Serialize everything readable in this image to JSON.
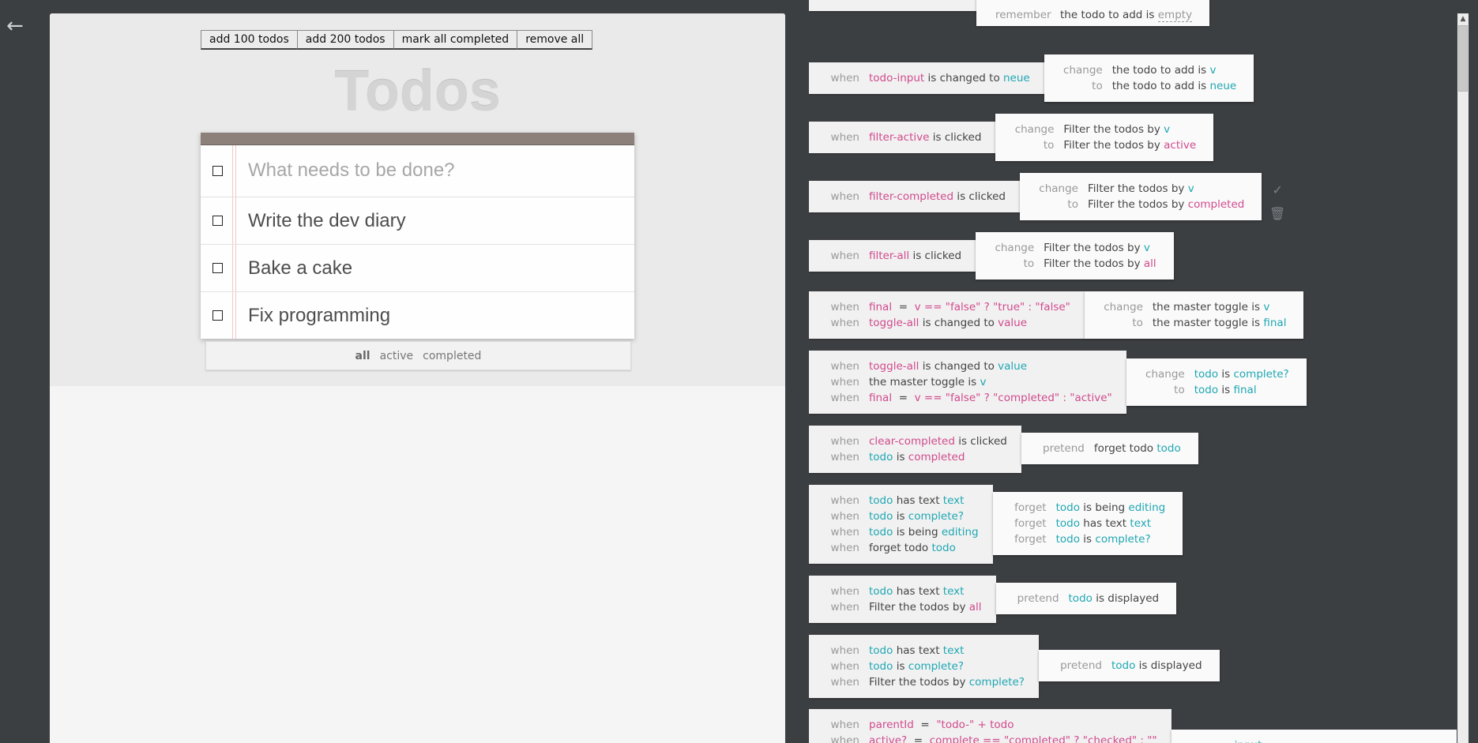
{
  "nav": {
    "back_glyph": "←",
    "back_icon": "arrow-left-icon"
  },
  "bench": {
    "add100": "add 100 todos",
    "add200": "add 200 todos",
    "mark_all": "mark all completed",
    "remove_all": "remove all"
  },
  "app": {
    "title": "Todos",
    "placeholder": "What needs to be done?",
    "todos": [
      {
        "text": "Write the dev diary",
        "complete": false
      },
      {
        "text": "Bake a cake",
        "complete": false
      },
      {
        "text": "Fix programming",
        "complete": false
      }
    ],
    "filters": {
      "all": "all",
      "active": "active",
      "completed": "completed",
      "selected": "all"
    }
  },
  "code": {
    "b0": {
      "r1_kw": "remember",
      "r1_a": "the todo to add is",
      "r1_b": "empty"
    },
    "b1": {
      "l1_kw": "when",
      "l1_tag": "todo-input",
      "l1_mid": "is changed to",
      "l1_tag2": "neue",
      "r1_kw": "change",
      "r1_a": "the todo to add is",
      "r1_v": "v",
      "r2_kw": "to",
      "r2_a": "the todo to add is",
      "r2_v": "neue"
    },
    "b2": {
      "l1_kw": "when",
      "l1_tag": "filter-active",
      "l1_mid": "is clicked",
      "r1_kw": "change",
      "r1_a": "Filter the todos by",
      "r1_v": "v",
      "r2_kw": "to",
      "r2_a": "Filter the todos by",
      "r2_t": "active"
    },
    "b3": {
      "l1_kw": "when",
      "l1_tag": "filter-completed",
      "l1_mid": "is clicked",
      "r1_kw": "change",
      "r1_a": "Filter the todos by",
      "r1_v": "v",
      "r2_kw": "to",
      "r2_a": "Filter the todos by",
      "r2_t": "completed"
    },
    "b4": {
      "l1_kw": "when",
      "l1_tag": "filter-all",
      "l1_mid": "is clicked",
      "r1_kw": "change",
      "r1_a": "Filter the todos by",
      "r1_v": "v",
      "r2_kw": "to",
      "r2_a": "Filter the todos by",
      "r2_t": "all"
    },
    "b5": {
      "l1_kw": "when",
      "l1_tag": "final",
      "l1_eq": "=",
      "l1_v": "v",
      "l1_expr": "== \"false\" ? \"true\" : \"false\"",
      "l2_kw": "when",
      "l2_tag": "toggle-all",
      "l2_mid": "is changed to",
      "l2_t": "value",
      "r1_kw": "change",
      "r1_a": "the master toggle is",
      "r1_v": "v",
      "r2_kw": "to",
      "r2_a": "the master toggle is",
      "r2_v": "final"
    },
    "b6": {
      "l1_kw": "when",
      "l1_tag": "toggle-all",
      "l1_mid": "is changed to",
      "l1_v": "value",
      "l2_kw": "when",
      "l2_a": "the master toggle is",
      "l2_v": "v",
      "l3_kw": "when",
      "l3_tag": "final",
      "l3_eq": "=",
      "l3_v": "v",
      "l3_expr": "== \"false\" ? \"completed\" : \"active\"",
      "r1_kw": "change",
      "r1_v": "todo",
      "r1_mid": "is",
      "r1_v2": "complete?",
      "r2_kw": "to",
      "r2_v": "todo",
      "r2_mid": "is",
      "r2_v2": "final"
    },
    "b7": {
      "l1_kw": "when",
      "l1_tag": "clear-completed",
      "l1_mid": "is clicked",
      "l2_kw": "when",
      "l2_v": "todo",
      "l2_mid": "is",
      "l2_t": "completed",
      "r1_kw": "pretend",
      "r1_a": "forget todo",
      "r1_v": "todo"
    },
    "b8": {
      "l1_kw": "when",
      "l1_v": "todo",
      "l1_mid": "has text",
      "l1_v2": "text",
      "l2_kw": "when",
      "l2_v": "todo",
      "l2_mid": "is",
      "l2_v2": "complete?",
      "l3_kw": "when",
      "l3_v": "todo",
      "l3_mid": "is being",
      "l3_v2": "editing",
      "l4_kw": "when",
      "l4_a": "forget todo",
      "l4_v": "todo",
      "r1_kw": "forget",
      "r1_v": "todo",
      "r1_mid": "is being",
      "r1_v2": "editing",
      "r2_kw": "forget",
      "r2_v": "todo",
      "r2_mid": "has text",
      "r2_v2": "text",
      "r3_kw": "forget",
      "r3_v": "todo",
      "r3_mid": "is",
      "r3_v2": "complete?"
    },
    "b9": {
      "l1_kw": "when",
      "l1_v": "todo",
      "l1_mid": "has text",
      "l1_v2": "text",
      "l2_kw": "when",
      "l2_a": "Filter the todos by",
      "l2_t": "all",
      "r1_kw": "pretend",
      "r1_v": "todo",
      "r1_mid": "is displayed"
    },
    "b10": {
      "l1_kw": "when",
      "l1_v": "todo",
      "l1_mid": "has text",
      "l1_v2": "text",
      "l2_kw": "when",
      "l2_v": "todo",
      "l2_mid": "is",
      "l2_v2": "complete?",
      "l3_kw": "when",
      "l3_a": "Filter the todos by",
      "l3_v": "complete?",
      "r1_kw": "pretend",
      "r1_v": "todo",
      "r1_mid": "is displayed"
    },
    "b11": {
      "l1_kw": "when",
      "l1_tag": "parentId",
      "l1_eq": "=",
      "l1_str": "\"todo-\" + todo",
      "l2_kw": "when",
      "l2_tag": "active?",
      "l2_eq": "=",
      "l2_str": "complete == \"completed\" ? \"checked\" : \"\"",
      "r1_v": "input"
    }
  },
  "icons": {
    "check": "✓",
    "trash": "🗑",
    "check_name": "check-icon",
    "trash_name": "trash-icon",
    "scroll_up": "▲"
  },
  "colors": {
    "tag": "#d14a8d",
    "value": "#1fa7b3",
    "panel_bg": "#3c3f42",
    "todo_header": "#8d7f7a"
  }
}
